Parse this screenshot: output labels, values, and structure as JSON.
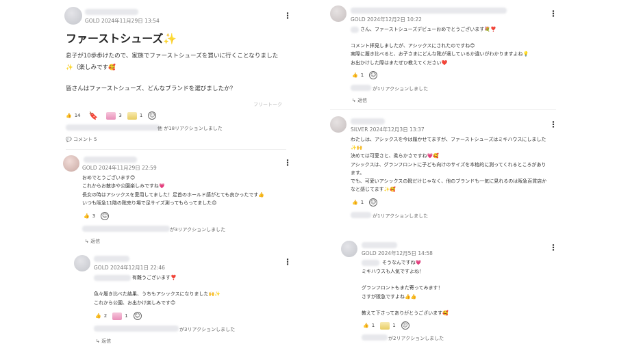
{
  "post": {
    "date": "GOLD 2024年11月29日 13:54",
    "title": "ファーストシューズ✨",
    "body": [
      "息子が10歩歩けたので、家族でファーストシューズを買いに行くことなりました",
      "✨（楽しみです🥰",
      "",
      "皆さんはファーストシューズ、どんなブランドを選びましたか？"
    ],
    "tag": "フリートーク",
    "reactions": [
      "14",
      "3",
      "1"
    ],
    "reaction_summary": "他 が18リアクションしました",
    "comment_count": "コメント 5"
  },
  "comments": [
    {
      "date": "GOLD 2024年11月29日 22:59",
      "body": [
        "おめでとうございます😊",
        "これからお散歩や公園楽しみですね💗",
        "長女の時はアシックスを愛用してました！足首のホールド感がとても良かったです👍",
        "いつも阪急11階の靴売り場で足サイズ測ってもらってました😊"
      ],
      "reactions": [
        "3"
      ],
      "reaction_summary": "が3リアクションしました",
      "reply": "返信"
    },
    {
      "date": "GOLD 2024年12月1日 22:46",
      "body": [
        "有難うございます❣️",
        "",
        "色々履き比べた結果、うちもアシックスになりました🙌✨",
        "これから公園、お出かけ楽しみです😊"
      ],
      "reactions": [
        "2",
        "1"
      ],
      "reaction_summary": "が3リアクションしました",
      "reply": "返信"
    },
    {
      "date": "GOLD 2024年12月2日 10:22",
      "body": [
        "さん、ファーストシューズデビューおめでとうございます💐❣️",
        "",
        "コメント拝見しましたが、アシックスにされたのですね😊",
        "実際に履き比べると、お子さまにどんな靴が適しているか違いがわかりますよね💡",
        "お出かけした際はまたぜひ教えてください❤️"
      ],
      "reactions": [
        "1"
      ],
      "reaction_summary": "が1リアクションしました",
      "reply": "返信"
    },
    {
      "date": "SILVER 2024年12月3日 13:37",
      "body": [
        "わたしは、アシックスを今は履かせてますが、ファーストシューズはミキハウスにしました",
        "✨🙌",
        "決めては可愛さと、柔らかさですね💗🥰",
        "アシックスは、グランフロントに子ども向けのサイズを本格的に測ってくれるところがあり",
        "ます。",
        "でも、可愛いアシックスの靴だけじゃなく、他のブランドも一気に見れるのは阪急百貨店か",
        "なと感じてます✨🥰"
      ],
      "reactions": [
        "1"
      ],
      "reaction_summary": "が1リアクションしました",
      "reply": "返信"
    },
    {
      "date": "GOLD 2024年12月5日 14:58",
      "body": [
        "そうなんですね💗",
        "ミキハウスも人気ですよね！",
        "",
        "グランフロントもまた寄ってみます！",
        "さすが阪急ですよね👍👍",
        "",
        "教えて下さってありがとうございます🥰"
      ],
      "reactions": [
        "1",
        "1"
      ],
      "reaction_summary": "が2リアクションしました"
    }
  ]
}
